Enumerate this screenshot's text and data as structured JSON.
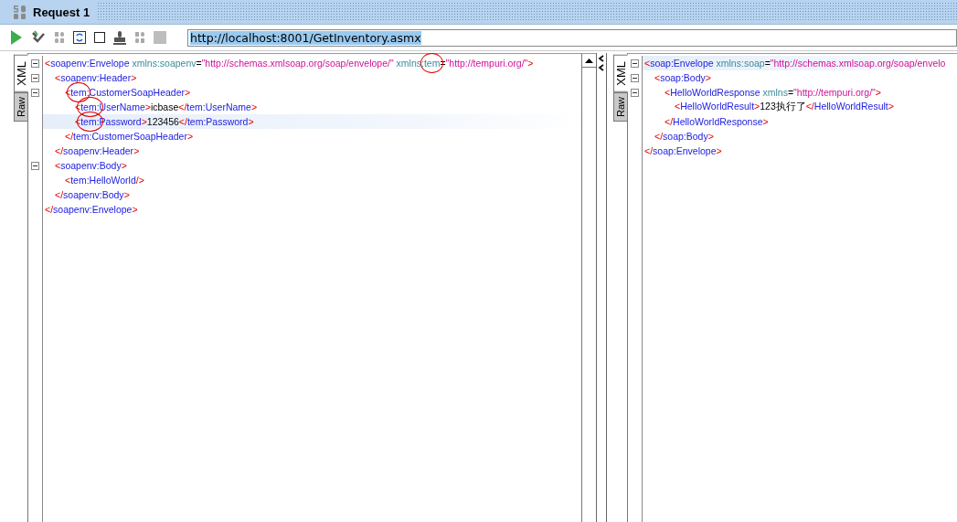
{
  "window": {
    "title": "Request 1"
  },
  "toolbar": {
    "url": "http://localhost:8001/GetInventory.asmx",
    "url_selected": true
  },
  "request_pane": {
    "tabs": [
      {
        "label": "XML",
        "selected": true
      },
      {
        "label": "Raw",
        "selected": false
      }
    ],
    "lines": [
      {
        "current": false,
        "expanded": true,
        "tokens": [
          {
            "kind": "punct",
            "text": "<"
          },
          {
            "kind": "tag",
            "text": "soapenv:Envelope"
          },
          {
            "kind": "attr",
            "text": " xmlns:soapenv"
          },
          {
            "kind": "eq",
            "text": "="
          },
          {
            "kind": "value",
            "text": "\"http://schemas.xmlsoap.org/soap/envelope/\""
          },
          {
            "kind": "attr",
            "text": " xmlns:"
          },
          {
            "kind": "attr",
            "text": "tem",
            "circled": true
          },
          {
            "kind": "eq",
            "text": "="
          },
          {
            "kind": "value",
            "text": "\"http://tempuri.org/\""
          },
          {
            "kind": "punct",
            "text": ">"
          }
        ],
        "children": [
          {
            "current": false,
            "expanded": true,
            "tokens": [
              {
                "kind": "punct",
                "text": "<"
              },
              {
                "kind": "tag",
                "text": "soapenv:Header"
              },
              {
                "kind": "punct",
                "text": ">"
              }
            ],
            "children": [
              {
                "current": false,
                "expanded": true,
                "tokens": [
                  {
                    "kind": "punct",
                    "text": "<"
                  },
                  {
                    "kind": "tag",
                    "text": "tem",
                    "circled": true
                  },
                  {
                    "kind": "tag",
                    "text": ":CustomerSoapHeader"
                  },
                  {
                    "kind": "punct",
                    "text": ">"
                  }
                ],
                "children": [
                  {
                    "current": false,
                    "tokens": [
                      {
                        "kind": "punct",
                        "text": "<"
                      },
                      {
                        "kind": "tag",
                        "text": "tem:",
                        "circled": true
                      },
                      {
                        "kind": "tag",
                        "text": "UserName"
                      },
                      {
                        "kind": "punct",
                        "text": ">"
                      },
                      {
                        "kind": "text",
                        "text": "icbase"
                      },
                      {
                        "kind": "punct",
                        "text": "</"
                      },
                      {
                        "kind": "tag",
                        "text": "tem:UserName"
                      },
                      {
                        "kind": "punct",
                        "text": ">"
                      }
                    ]
                  },
                  {
                    "current": true,
                    "tokens": [
                      {
                        "kind": "punct",
                        "text": "<"
                      },
                      {
                        "kind": "tag",
                        "text": "tem:",
                        "circled": true
                      },
                      {
                        "kind": "tag",
                        "text": "Password"
                      },
                      {
                        "kind": "punct",
                        "text": ">"
                      },
                      {
                        "kind": "text",
                        "text": "123456"
                      },
                      {
                        "kind": "punct",
                        "text": "</"
                      },
                      {
                        "kind": "tag",
                        "text": "tem:Password"
                      },
                      {
                        "kind": "punct",
                        "text": ">"
                      }
                    ]
                  }
                ],
                "end": [
                  {
                    "kind": "punct",
                    "text": "</"
                  },
                  {
                    "kind": "tag",
                    "text": "tem:CustomerSoapHeader"
                  },
                  {
                    "kind": "punct",
                    "text": ">"
                  }
                ]
              }
            ],
            "end": [
              {
                "kind": "punct",
                "text": "</"
              },
              {
                "kind": "tag",
                "text": "soapenv:Header"
              },
              {
                "kind": "punct",
                "text": ">"
              }
            ]
          },
          {
            "current": false,
            "expanded": true,
            "tokens": [
              {
                "kind": "punct",
                "text": "<"
              },
              {
                "kind": "tag",
                "text": "soapenv:Body"
              },
              {
                "kind": "punct",
                "text": ">"
              }
            ],
            "children": [
              {
                "current": false,
                "tokens": [
                  {
                    "kind": "punct",
                    "text": "<"
                  },
                  {
                    "kind": "tag",
                    "text": "tem:HelloWorld"
                  },
                  {
                    "kind": "punct",
                    "text": "/>"
                  }
                ]
              }
            ],
            "end": [
              {
                "kind": "punct",
                "text": "</"
              },
              {
                "kind": "tag",
                "text": "soapenv:Body"
              },
              {
                "kind": "punct",
                "text": ">"
              }
            ]
          }
        ],
        "end": [
          {
            "kind": "punct",
            "text": "</"
          },
          {
            "kind": "tag",
            "text": "soapenv:Envelope"
          },
          {
            "kind": "punct",
            "text": ">"
          }
        ]
      }
    ]
  },
  "response_pane": {
    "tabs": [
      {
        "label": "XML",
        "selected": true
      },
      {
        "label": "Raw",
        "selected": false
      }
    ],
    "lines": [
      {
        "current": true,
        "expanded": true,
        "tokens": [
          {
            "kind": "punct",
            "text": "<"
          },
          {
            "kind": "tag",
            "text": "soap:Envelope"
          },
          {
            "kind": "attr",
            "text": " xmlns:soap"
          },
          {
            "kind": "eq",
            "text": "="
          },
          {
            "kind": "value",
            "text": "\"http://schemas.xmlsoap.org/soap/envelo"
          }
        ],
        "children": [
          {
            "current": false,
            "expanded": true,
            "tokens": [
              {
                "kind": "punct",
                "text": "<"
              },
              {
                "kind": "tag",
                "text": "soap:Body"
              },
              {
                "kind": "punct",
                "text": ">"
              }
            ],
            "children": [
              {
                "current": false,
                "expanded": true,
                "tokens": [
                  {
                    "kind": "punct",
                    "text": "<"
                  },
                  {
                    "kind": "tag",
                    "text": "HelloWorldResponse"
                  },
                  {
                    "kind": "attr",
                    "text": " xmlns"
                  },
                  {
                    "kind": "eq",
                    "text": "="
                  },
                  {
                    "kind": "value",
                    "text": "\"http://tempuri.org/\""
                  },
                  {
                    "kind": "punct",
                    "text": ">"
                  }
                ],
                "children": [
                  {
                    "current": false,
                    "tokens": [
                      {
                        "kind": "punct",
                        "text": "<"
                      },
                      {
                        "kind": "tag",
                        "text": "HelloWorldResult"
                      },
                      {
                        "kind": "punct",
                        "text": ">"
                      },
                      {
                        "kind": "text",
                        "text": "123执行了"
                      },
                      {
                        "kind": "punct",
                        "text": "</"
                      },
                      {
                        "kind": "tag",
                        "text": "HelloWorldResult"
                      },
                      {
                        "kind": "punct",
                        "text": ">"
                      }
                    ]
                  }
                ],
                "end": [
                  {
                    "kind": "punct",
                    "text": "</"
                  },
                  {
                    "kind": "tag",
                    "text": "HelloWorldResponse"
                  },
                  {
                    "kind": "punct",
                    "text": ">"
                  }
                ]
              }
            ],
            "end": [
              {
                "kind": "punct",
                "text": "</"
              },
              {
                "kind": "tag",
                "text": "soap:Body"
              },
              {
                "kind": "punct",
                "text": ">"
              }
            ]
          }
        ],
        "end": [
          {
            "kind": "punct",
            "text": "</"
          },
          {
            "kind": "tag",
            "text": "soap:Envelope"
          },
          {
            "kind": "punct",
            "text": ">"
          }
        ]
      }
    ]
  }
}
